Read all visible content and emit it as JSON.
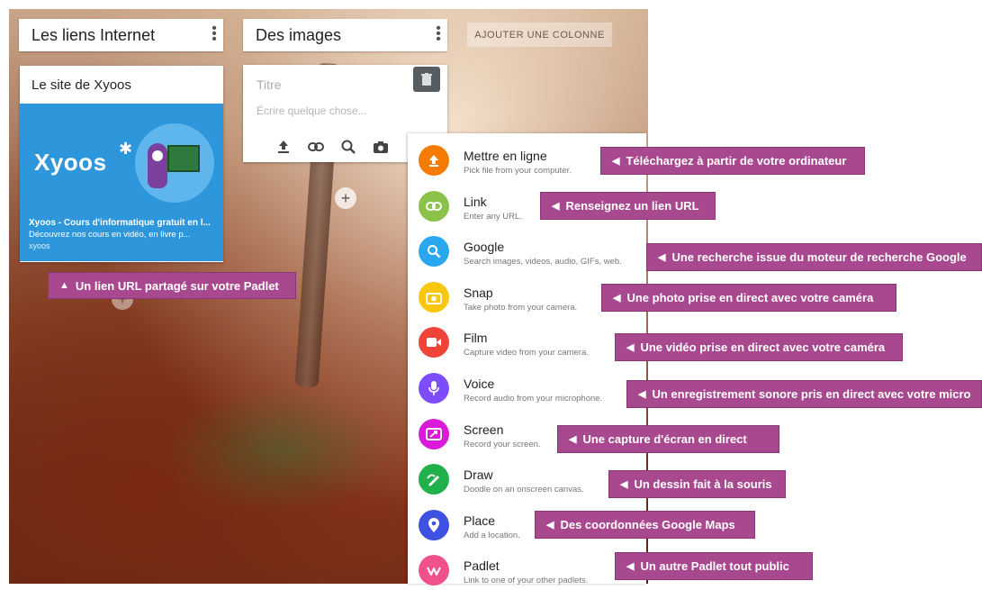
{
  "columns": [
    {
      "title": "Les liens Internet"
    },
    {
      "title": "Des images"
    }
  ],
  "add_column_label": "AJOUTER UNE COLONNE",
  "link_card": {
    "title": "Le site de Xyoos",
    "logo_text": "Xyoos",
    "preview_title": "Xyoos - Cours d'informatique gratuit en l...",
    "preview_desc": "Découvrez nos cours en vidéo, en livre p...",
    "preview_source": "xyoos"
  },
  "new_post": {
    "title_placeholder": "Titre",
    "body_placeholder": "Écrire quelque chose..."
  },
  "callout_link": "Un lien URL partagé sur votre Padlet",
  "menu": [
    {
      "label": "Mettre en ligne",
      "sub": "Pick file from your computer.",
      "color": "#f57c00",
      "icon": "upload-icon",
      "callout": "Téléchargez à partir de votre ordinateur"
    },
    {
      "label": "Link",
      "sub": "Enter any URL.",
      "color": "#8bc34a",
      "icon": "link-icon",
      "callout": "Renseignez un lien URL"
    },
    {
      "label": "Google",
      "sub": "Search images, videos, audio, GIFs, web.",
      "color": "#29a8f0",
      "icon": "search-icon",
      "callout": "Une recherche issue du moteur de recherche Google"
    },
    {
      "label": "Snap",
      "sub": "Take photo from your camera.",
      "color": "#f9c80e",
      "icon": "camera-icon",
      "callout": "Une photo prise en direct avec votre caméra"
    },
    {
      "label": "Film",
      "sub": "Capture video from your camera.",
      "color": "#f04438",
      "icon": "video-icon",
      "callout": "Une vidéo prise en direct avec votre caméra"
    },
    {
      "label": "Voice",
      "sub": "Record audio from your microphone.",
      "color": "#7c4dff",
      "icon": "microphone-icon",
      "callout": "Un enregistrement sonore pris en direct avec votre micro"
    },
    {
      "label": "Screen",
      "sub": "Record your screen.",
      "color": "#d91ad8",
      "icon": "screen-icon",
      "callout": "Une capture d'écran en direct"
    },
    {
      "label": "Draw",
      "sub": "Doodle on an onscreen canvas.",
      "color": "#21b04b",
      "icon": "draw-icon",
      "callout": "Un dessin fait à la souris"
    },
    {
      "label": "Place",
      "sub": "Add a location.",
      "color": "#3f51e0",
      "icon": "location-pin-icon",
      "callout": "Des coordonnées Google Maps"
    },
    {
      "label": "Padlet",
      "sub": "Link to one of your other padlets.",
      "color": "#f0508c",
      "icon": "padlet-icon",
      "callout": "Un autre Padlet tout public"
    }
  ]
}
